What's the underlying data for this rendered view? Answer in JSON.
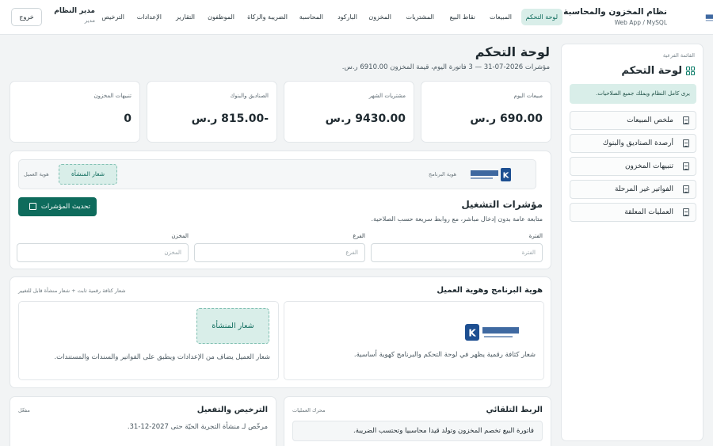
{
  "app": {
    "name": "نظام المخزون والمحاسبة",
    "platform": "Web App / MySQL",
    "logo_text": "كثافة رقمية"
  },
  "nav": {
    "items": [
      {
        "label": "لوحة التحكم",
        "active": true
      },
      {
        "label": "المبيعات",
        "active": false
      },
      {
        "label": "نقاط البيع",
        "active": false
      },
      {
        "label": "المشتريات",
        "active": false
      },
      {
        "label": "المخزون",
        "active": false
      },
      {
        "label": "الباركود",
        "active": false
      },
      {
        "label": "المحاسبة",
        "active": false
      },
      {
        "label": "الضريبة والزكاة",
        "active": false
      },
      {
        "label": "الموظفون",
        "active": false
      },
      {
        "label": "التقارير",
        "active": false
      },
      {
        "label": "الإعدادات",
        "active": false
      },
      {
        "label": "الترخيص",
        "active": false
      }
    ]
  },
  "user": {
    "name": "مدير النظام",
    "role": "مدير",
    "logout_label": "خروج"
  },
  "sidebar": {
    "caption": "القائمة الفرعية",
    "title": "لوحة التحكم",
    "note": "يرى كامل النظام ويملك جميع الصلاحيات.",
    "items": [
      {
        "label": "ملخص المبيعات"
      },
      {
        "label": "أرصدة الصناديق والبنوك"
      },
      {
        "label": "تنبيهات المخزون"
      },
      {
        "label": "الفواتير غير المرحلة"
      },
      {
        "label": "العمليات المعلقة"
      }
    ]
  },
  "page": {
    "title": "لوحة التحكم",
    "subtitle": "مؤشرات 2026-07-31 — 3 فاتورة اليوم، قيمة المخزون 6910.00 ر.س."
  },
  "stats": [
    {
      "label": "مبيعات اليوم",
      "value": "690.00 ر.س"
    },
    {
      "label": "مشتريات الشهر",
      "value": "9430.00 ر.س"
    },
    {
      "label": "الصناديق والبنوك",
      "value": "-815.00 ر.س"
    },
    {
      "label": "تنبيهات المخزون",
      "value": "0"
    }
  ],
  "indicators": {
    "program_identity_label": "هوية البرنامج",
    "client_identity_label": "هوية العميل",
    "client_logo_placeholder": "شعار المنشأة",
    "title": "مؤشرات التشغيل",
    "subtitle": "متابعة عامة بدون إدخال مباشر، مع روابط سريعة حسب الصلاحية.",
    "refresh_label": "تحديث المؤشرات",
    "filters": [
      {
        "label": "الفترة",
        "placeholder": "الفترة"
      },
      {
        "label": "الفرع",
        "placeholder": "الفرع"
      },
      {
        "label": "المخزن",
        "placeholder": "المخزن"
      }
    ]
  },
  "identity": {
    "title": "هوية البرنامج وهوية العميل",
    "caption": "شعار كثافة رقمية ثابت + شعار منشأة قابل للتغيير",
    "program_text": "شعار كثافة رقمية يظهر في لوحة التحكم والبرنامج كهوية أساسية.",
    "client_badge": "شعار المنشأة",
    "client_text": "شعار العميل يضاف من الإعدادات ويطبق على الفواتير والسندات والمستندات."
  },
  "linking": {
    "title": "الربط التلقائي",
    "caption": "محرك العمليات",
    "rows": [
      {
        "text": "فاتورة البيع تخصم المخزون وتولد قيدا محاسبيا وتحتسب الضريبة."
      }
    ]
  },
  "license": {
    "title": "الترخيص والتفعيل",
    "status": "مفعّل",
    "text": "مرخّص لـ منشأة التجربة الحيّة حتى 2027-12-31."
  },
  "colors": {
    "accent": "#0e6b5c",
    "accent_light": "#d9eee9",
    "background": "#f2f4f5",
    "logo_blue": "#1d4f91"
  }
}
